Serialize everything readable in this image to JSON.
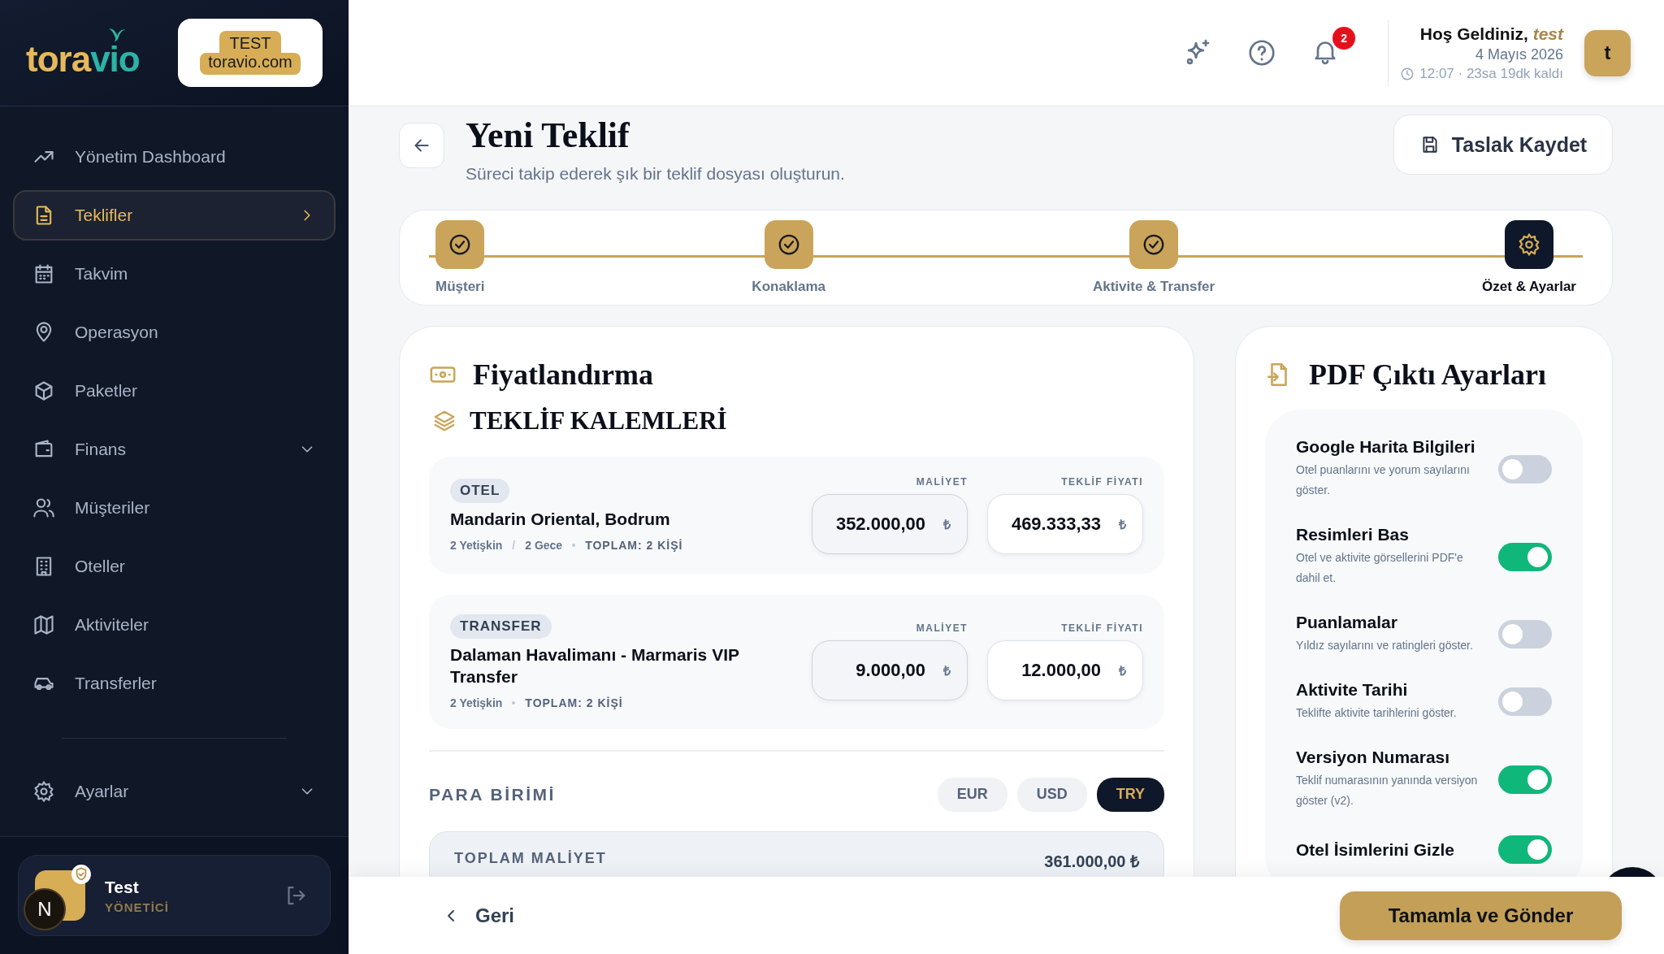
{
  "sidebar": {
    "logo": {
      "start": "tora",
      "end": "vio"
    },
    "env_badge": {
      "label": "TEST",
      "domain": "toravio.com"
    },
    "nav": [
      {
        "label": "Yönetim Dashboard",
        "selected": false,
        "expandable": false
      },
      {
        "label": "Teklifler",
        "selected": true,
        "expandable": true
      },
      {
        "label": "Takvim",
        "selected": false,
        "expandable": false
      },
      {
        "label": "Operasyon",
        "selected": false,
        "expandable": false
      },
      {
        "label": "Paketler",
        "selected": false,
        "expandable": false
      },
      {
        "label": "Finans",
        "selected": false,
        "expandable": true
      },
      {
        "label": "Müşteriler",
        "selected": false,
        "expandable": false
      },
      {
        "label": "Oteller",
        "selected": false,
        "expandable": false
      },
      {
        "label": "Aktiviteler",
        "selected": false,
        "expandable": false
      },
      {
        "label": "Transferler",
        "selected": false,
        "expandable": false
      }
    ],
    "bottom_nav": [
      {
        "label": "Ayarlar",
        "selected": false,
        "expandable": true
      }
    ],
    "user": {
      "name": "Test",
      "role": "YÖNETİCİ",
      "dev_indicator": "N"
    }
  },
  "header": {
    "notifications": "2",
    "greeting": "Hoş Geldiniz,",
    "user_name": "test",
    "date": "4 Mayıs 2026",
    "time": "12:07 · 23sa 19dk kaldı",
    "avatar": "t"
  },
  "page": {
    "title": "Yeni Teklif",
    "subtitle": "Süreci takip ederek şık bir teklif dosyası oluşturun.",
    "save_button": "Taslak Kaydet"
  },
  "steps": [
    {
      "label": "Müşteri",
      "done": true,
      "selected": false
    },
    {
      "label": "Konaklama",
      "done": true,
      "selected": false
    },
    {
      "label": "Aktivite & Transfer",
      "done": true,
      "selected": false
    },
    {
      "label": "Özet & Ayarlar",
      "done": false,
      "selected": true
    }
  ],
  "pricing": {
    "title": "Fiyatlandırma",
    "section": "TEKLİF KALEMLERİ",
    "items": [
      {
        "tag": "OTEL",
        "name": "Mandarin Oriental, Bodrum",
        "details": [
          "2 Yetişkin",
          "2 Gece"
        ],
        "detail_separator": "/",
        "total": "TOPLAM: 2 KİŞİ",
        "cost": {
          "label": "MALİYET",
          "value": "352.000,00",
          "currency": "₺"
        },
        "price": {
          "label": "TEKLİF FİYATI",
          "value": "469.333,33",
          "currency": "₺"
        }
      },
      {
        "tag": "TRANSFER",
        "name": "Dalaman Havalimanı - Marmaris VIP Transfer",
        "details": [
          "2 Yetişkin"
        ],
        "total": "TOPLAM: 2 KİŞİ",
        "cost": {
          "label": "MALİYET",
          "value": "9.000,00",
          "currency": "₺"
        },
        "price": {
          "label": "TEKLİF FİYATI",
          "value": "12.000,00",
          "currency": "₺"
        }
      }
    ],
    "currency_label": "PARA BİRİMİ",
    "currencies": [
      {
        "label": "EUR",
        "selected": false
      },
      {
        "label": "USD",
        "selected": false
      },
      {
        "label": "TRY",
        "selected": true
      }
    ],
    "total_cost": {
      "label": "TOPLAM MALİYET",
      "value": "361.000,00 ₺"
    }
  },
  "pdf_settings": {
    "title": "PDF Çıktı Ayarları",
    "options": [
      {
        "title": "Google Harita Bilgileri",
        "description": "Otel puanlarını ve yorum sayılarını göster.",
        "on": false
      },
      {
        "title": "Resimleri Bas",
        "description": "Otel ve aktivite görsellerini PDF'e dahil et.",
        "on": true
      },
      {
        "title": "Puanlamalar",
        "description": "Yıldız sayılarını ve ratingleri göster.",
        "on": false
      },
      {
        "title": "Aktivite Tarihi",
        "description": "Teklifte aktivite tarihlerini göster.",
        "on": false
      },
      {
        "title": "Versiyon Numarası",
        "description": "Teklif numarasının yanında versiyon göster (v2).",
        "on": true
      },
      {
        "title": "Otel İsimlerini Gizle",
        "on": true
      }
    ]
  },
  "footer": {
    "back": "Geri",
    "submit": "Tamamla ve Gönder"
  }
}
